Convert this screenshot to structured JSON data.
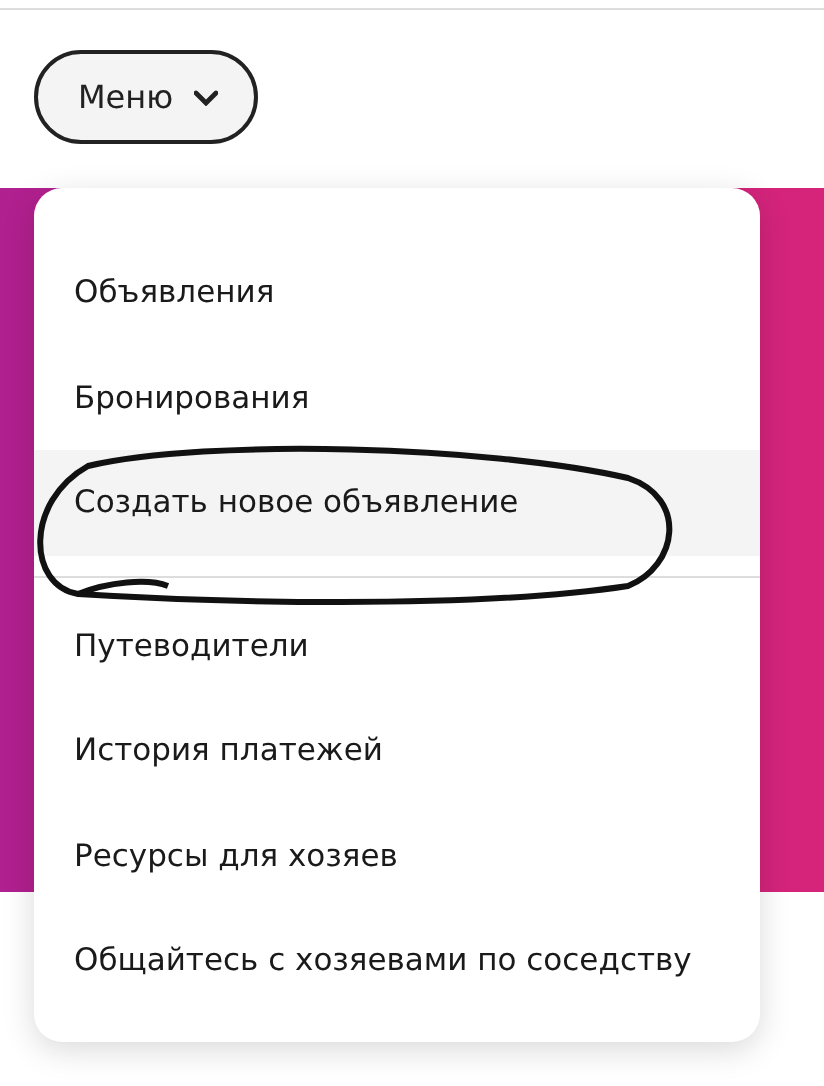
{
  "menu_button": {
    "label": "Меню",
    "expanded": true
  },
  "menu": {
    "sections": [
      {
        "items": [
          {
            "label": "Объявления",
            "highlighted": false,
            "circled": false
          },
          {
            "label": "Бронирования",
            "highlighted": false,
            "circled": false
          },
          {
            "label": "Создать новое объявление",
            "highlighted": true,
            "circled": true
          }
        ]
      },
      {
        "items": [
          {
            "label": "Путеводители",
            "highlighted": false,
            "circled": false
          },
          {
            "label": "История платежей",
            "highlighted": false,
            "circled": false
          },
          {
            "label": "Ресурсы для хозяев",
            "highlighted": false,
            "circled": false
          },
          {
            "label": "Общайтесь с хозяевами по соседству",
            "highlighted": false,
            "circled": false
          }
        ]
      }
    ]
  }
}
